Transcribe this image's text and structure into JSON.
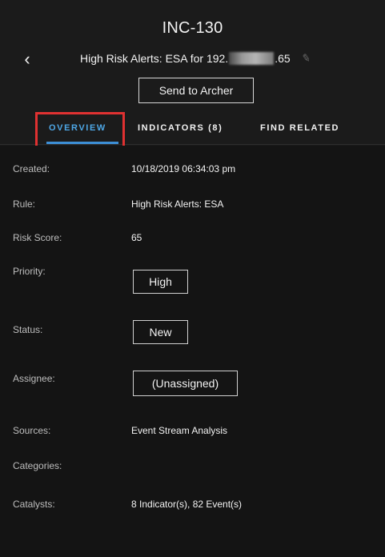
{
  "header": {
    "incident_id": "INC-130",
    "back_glyph": "‹",
    "title_prefix": "High Risk Alerts: ESA for 192.",
    "title_suffix": ".65",
    "edit_glyph": "✎",
    "send_button_label": "Send to Archer"
  },
  "tabs": [
    {
      "label": "OVERVIEW",
      "active": true
    },
    {
      "label": "INDICATORS (8)",
      "active": false
    },
    {
      "label": "FIND RELATED",
      "active": false
    }
  ],
  "overview": {
    "created_label": "Created:",
    "created_value": "10/18/2019 06:34:03 pm",
    "rule_label": "Rule:",
    "rule_value": "High Risk Alerts: ESA",
    "risk_score_label": "Risk Score:",
    "risk_score_value": "65",
    "priority_label": "Priority:",
    "priority_value": "High",
    "status_label": "Status:",
    "status_value": "New",
    "assignee_label": "Assignee:",
    "assignee_value": "(Unassigned)",
    "sources_label": "Sources:",
    "sources_value": "Event Stream Analysis",
    "categories_label": "Categories:",
    "catalysts_label": "Catalysts:",
    "catalysts_value": "8 Indicator(s), 82 Event(s)"
  },
  "colors": {
    "background": "#1b1b1b",
    "content_background": "#141414",
    "active_tab": "#4ea7e6",
    "highlight": "#e03131"
  }
}
